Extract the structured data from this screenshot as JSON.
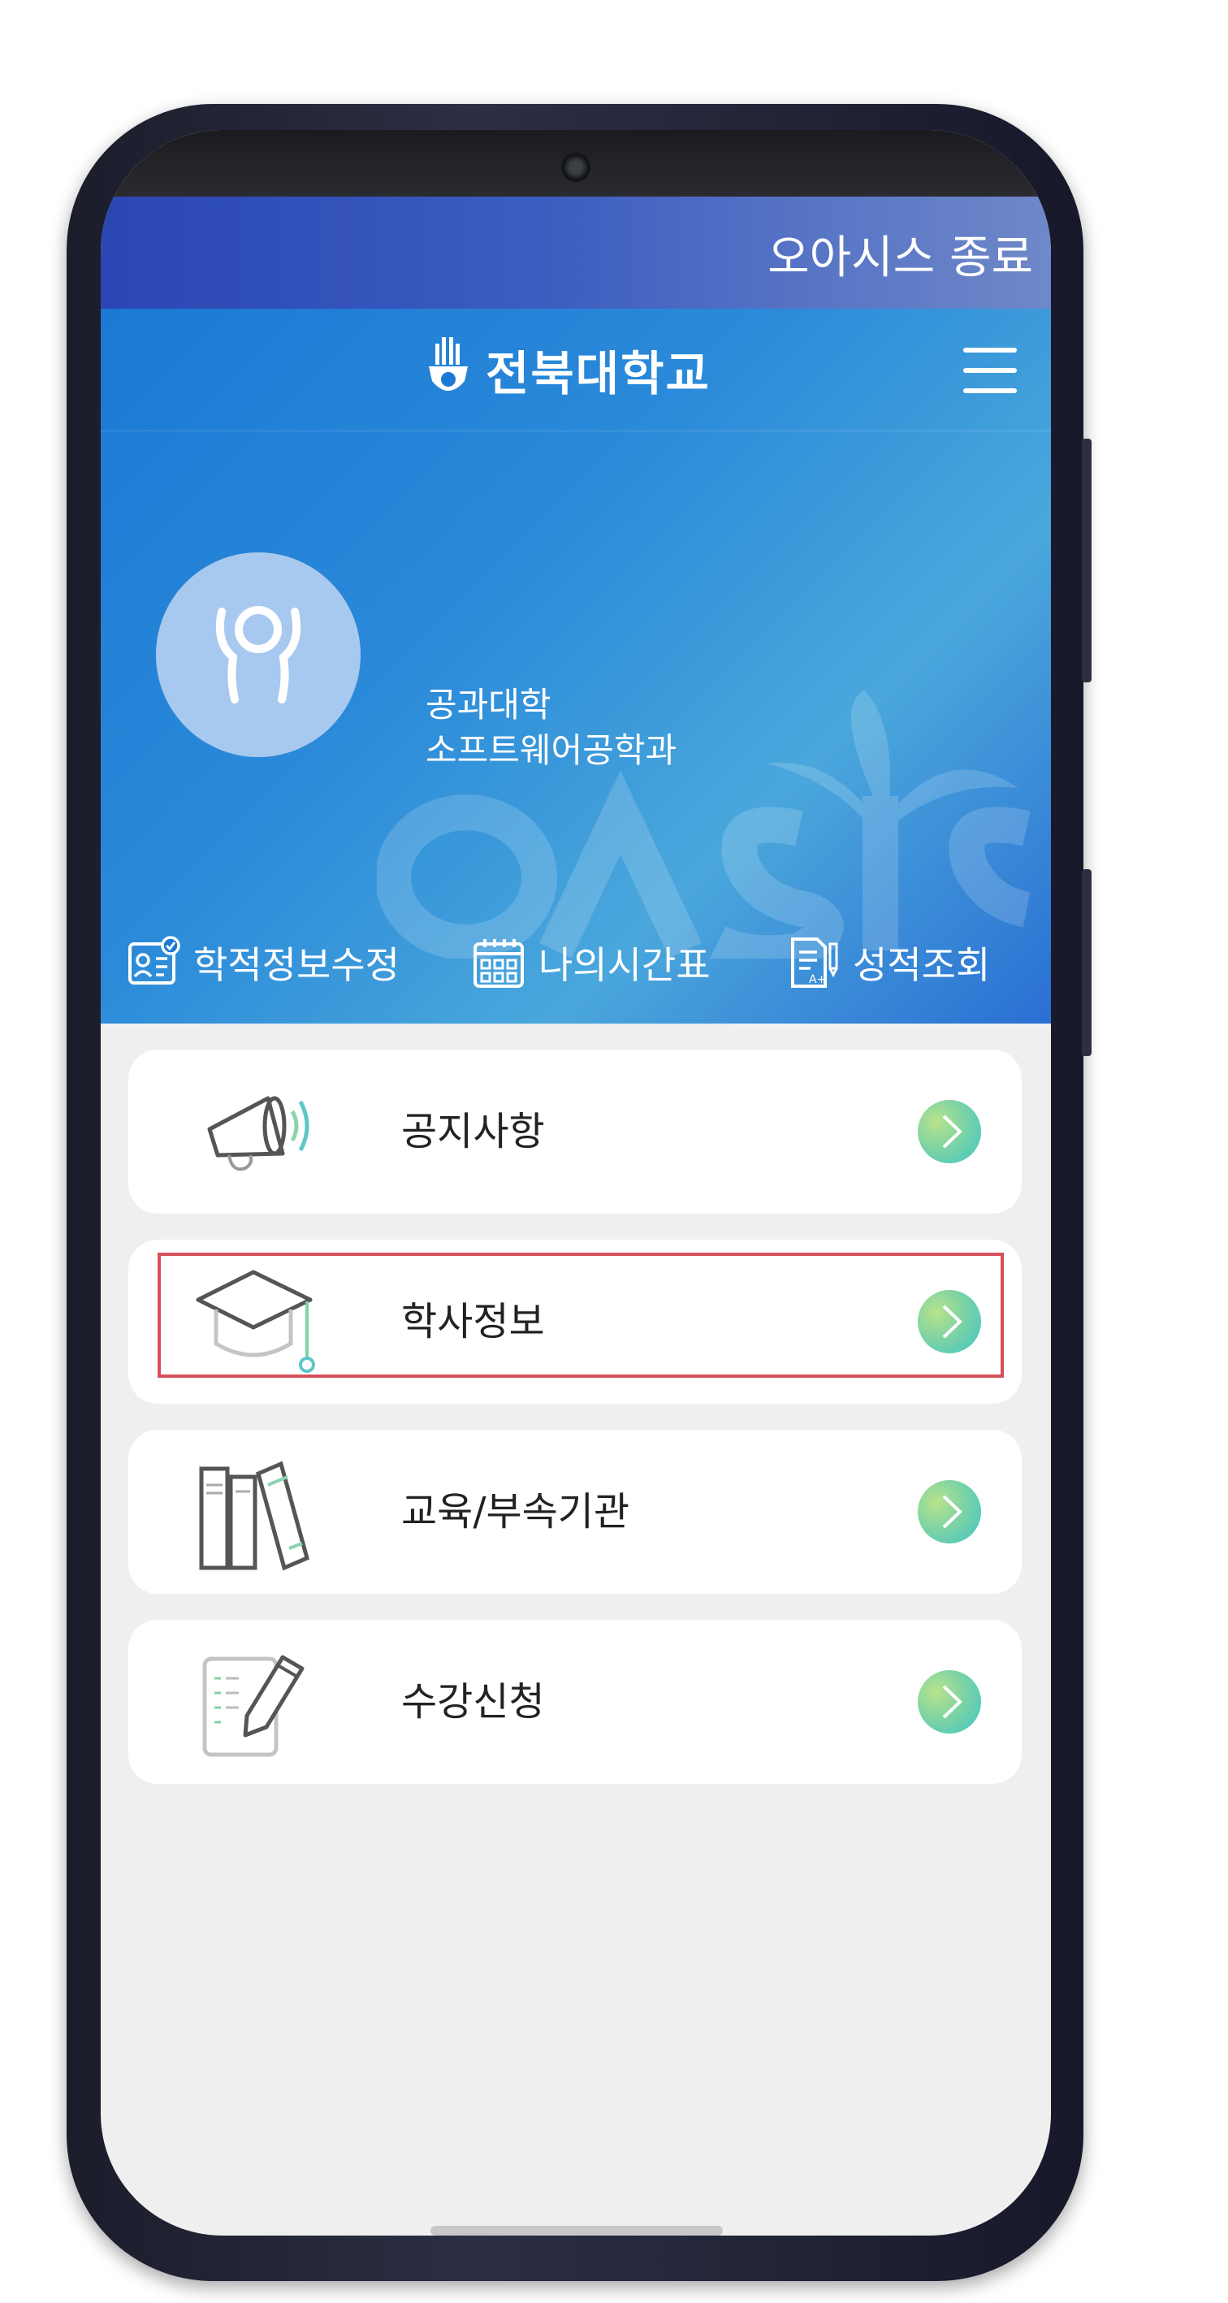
{
  "topbar": {
    "exit_label": "오아시스 종료"
  },
  "header": {
    "logo_text": "전북대학교"
  },
  "profile": {
    "college": "공과대학",
    "department": "소프트웨어공학과"
  },
  "quick_links": [
    {
      "label": "학적정보수정",
      "icon": "student-card-icon"
    },
    {
      "label": "나의시간표",
      "icon": "calendar-icon"
    },
    {
      "label": "성적조회",
      "icon": "grade-report-icon"
    }
  ],
  "menu": [
    {
      "label": "공지사항",
      "icon": "megaphone-icon"
    },
    {
      "label": "학사정보",
      "icon": "graduation-cap-icon",
      "highlighted": true
    },
    {
      "label": "교육/부속기관",
      "icon": "books-icon"
    },
    {
      "label": "수강신청",
      "icon": "registration-pencil-icon"
    }
  ],
  "colors": {
    "highlight": "#d6505a",
    "brand_blue": "#1b78d4",
    "arrow_green": "#7ed3a3"
  }
}
